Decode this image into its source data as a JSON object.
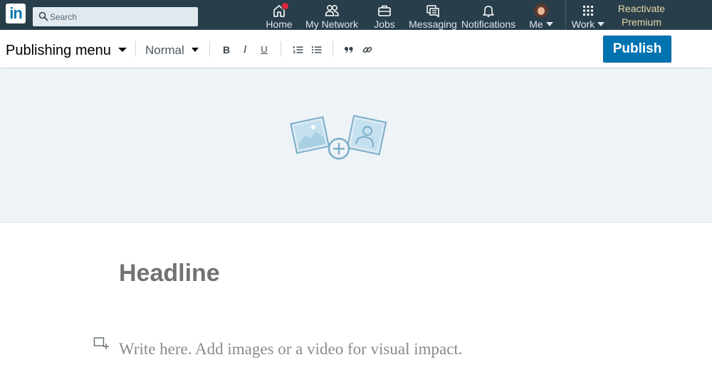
{
  "nav": {
    "logo_text": "in",
    "search_placeholder": "Search",
    "items": [
      {
        "label": "Home",
        "icon": "home-icon",
        "badge": true
      },
      {
        "label": "My Network",
        "icon": "my-network-icon"
      },
      {
        "label": "Jobs",
        "icon": "briefcase-icon"
      },
      {
        "label": "Messaging",
        "icon": "messaging-icon"
      },
      {
        "label": "Notifications",
        "icon": "bell-icon"
      },
      {
        "label": "Me",
        "icon": "avatar"
      },
      {
        "label": "Work",
        "icon": "grid-icon"
      }
    ],
    "premium_line1": "Reactivate",
    "premium_line2": "Premium",
    "colors": {
      "bar": "#283e4a",
      "badge": "#e0243b",
      "premium": "#e7d9a8"
    }
  },
  "toolbar": {
    "publishing_menu": "Publishing menu",
    "text_style": "Normal",
    "buttons": [
      "bold-icon",
      "italic-icon",
      "underline-icon",
      "numbered-list-icon",
      "bulleted-list-icon",
      "quote-icon",
      "link-icon"
    ],
    "bold_glyph": "B",
    "italic_glyph": "I",
    "underline_glyph": "U",
    "publish_label": "Publish",
    "colors": {
      "publish": "#0073b1"
    }
  },
  "cover": {
    "icon": "add-cover-image-icon",
    "colors": {
      "background": "#eef3f7",
      "icon": "#7aaec9"
    }
  },
  "article": {
    "headline_placeholder": "Headline",
    "body_placeholder": "Write here. Add images or a video for visual impact."
  }
}
